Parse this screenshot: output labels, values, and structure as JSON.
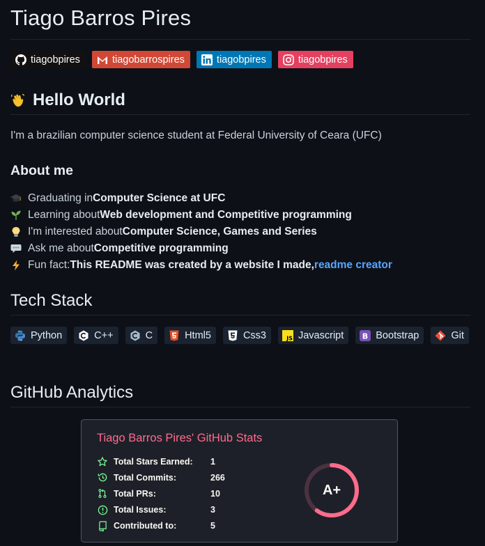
{
  "profile": {
    "name": "Tiago Barros Pires"
  },
  "social": [
    {
      "label": "tiagobpires",
      "icon": "github-icon"
    },
    {
      "label": "tiagobarrospires",
      "icon": "gmail-icon"
    },
    {
      "label": "tiagobpires",
      "icon": "linkedin-icon"
    },
    {
      "label": "tiagobpires",
      "icon": "instagram-icon"
    }
  ],
  "hello": {
    "heading": "Hello World",
    "intro": "I'm a brazilian computer science student at Federal University of Ceara (UFC)"
  },
  "about": {
    "heading": "About me",
    "items": [
      {
        "icon": "graduation-cap-icon",
        "text": "Graduating in ",
        "bold": "Computer Science at UFC"
      },
      {
        "icon": "seedling-icon",
        "text": "Learning about ",
        "bold": "Web development and Competitive programming"
      },
      {
        "icon": "light-bulb-icon",
        "text": "I'm interested about ",
        "bold": "Computer Science, Games and Series"
      },
      {
        "icon": "speech-bubble-icon",
        "text": "Ask me about ",
        "bold": "Competitive programming"
      },
      {
        "icon": "lightning-icon",
        "text": "Fun fact: ",
        "bold": "This README was created by a website I made, ",
        "link": "readme creator"
      }
    ]
  },
  "tech": {
    "heading": "Tech Stack",
    "items": [
      {
        "label": "Python",
        "icon": "python-icon"
      },
      {
        "label": "C++",
        "icon": "cplusplus-icon"
      },
      {
        "label": "C",
        "icon": "c-icon"
      },
      {
        "label": "Html5",
        "icon": "html5-icon"
      },
      {
        "label": "Css3",
        "icon": "css3-icon"
      },
      {
        "label": "Javascript",
        "icon": "javascript-icon"
      },
      {
        "label": "Bootstrap",
        "icon": "bootstrap-icon"
      },
      {
        "label": "Git",
        "icon": "git-icon"
      }
    ]
  },
  "analytics": {
    "heading": "GitHub Analytics",
    "card_title": "Tiago Barros Pires' GitHub Stats",
    "stats": [
      {
        "label": "Total Stars Earned:",
        "value": "1",
        "icon": "star-icon"
      },
      {
        "label": "Total Commits:",
        "value": "266",
        "icon": "history-icon"
      },
      {
        "label": "Total PRs:",
        "value": "10",
        "icon": "pull-request-icon"
      },
      {
        "label": "Total Issues:",
        "value": "3",
        "icon": "issue-icon"
      },
      {
        "label": "Contributed to:",
        "value": "5",
        "icon": "repo-icon"
      }
    ],
    "grade": "A+",
    "grade_progress": 0.6
  },
  "colors": {
    "background": "#0d1117",
    "card_title": "#fe6b8b",
    "link": "#58a6ff"
  }
}
